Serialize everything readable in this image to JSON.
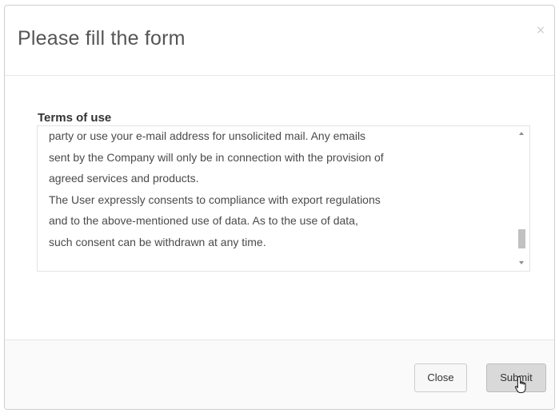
{
  "dialog": {
    "title": "Please fill the form",
    "close_glyph": "×",
    "close_icon": "close-icon"
  },
  "body": {
    "terms_label": "Terms of use",
    "terms_text": "party or use your e-mail address for unsolicited mail. Any emails\nsent by the Company will only be in connection with the provision of\nagreed services and products.\nThe User expressly consents to compliance with export regulations\nand to the above-mentioned use of data. As to the use of data,\nsuch consent can be withdrawn at any time.",
    "scroll_position": 0.9
  },
  "footer": {
    "close_label": "Close",
    "submit_label": "Submit"
  },
  "colors": {
    "title": "#555555",
    "submit_bg": "#d9d9d9",
    "close_bg": "#f7f7f7"
  },
  "cursor": {
    "icon": "hand-pointer-icon"
  }
}
